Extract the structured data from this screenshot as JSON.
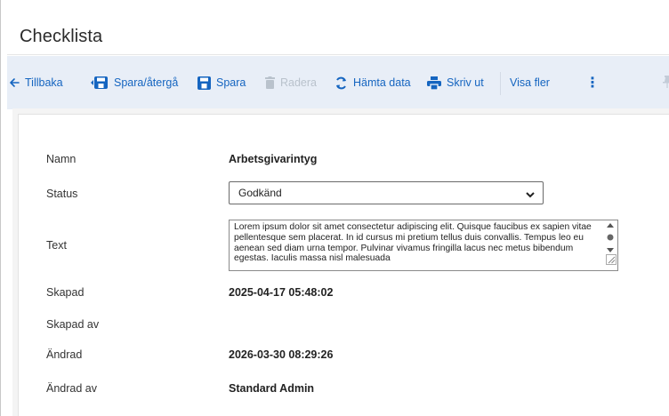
{
  "page": {
    "title": "Checklista"
  },
  "toolbar": {
    "back": "Tillbaka",
    "save_return": "Spara/återgå",
    "save": "Spara",
    "delete": "Radera",
    "fetch": "Hämta data",
    "print": "Skriv ut",
    "more": "Visa fler",
    "kebab": "⋮"
  },
  "form": {
    "name_label": "Namn",
    "name_value": "Arbetsgivarintyg",
    "status_label": "Status",
    "status_value": "Godkänd",
    "text_label": "Text",
    "text_value": "Lorem ipsum dolor sit amet consectetur adipiscing elit. Quisque faucibus ex sapien vitae pellentesque sem placerat. In id cursus mi pretium tellus duis convallis. Tempus leo eu aenean sed diam urna tempor. Pulvinar vivamus fringilla lacus nec metus bibendum egestas. Iaculis massa nisl malesuada",
    "created_label": "Skapad",
    "created_value": "2025-04-17 05:48:02",
    "created_by_label": "Skapad av",
    "created_by_value": "",
    "modified_label": "Ändrad",
    "modified_value": "2026-03-30 08:29:26",
    "modified_by_label": "Ändrad av",
    "modified_by_value": "Standard Admin"
  },
  "colors": {
    "accent": "#1565c0",
    "toolbar_bg": "#e8eef7",
    "disabled": "#b9c2cc"
  }
}
